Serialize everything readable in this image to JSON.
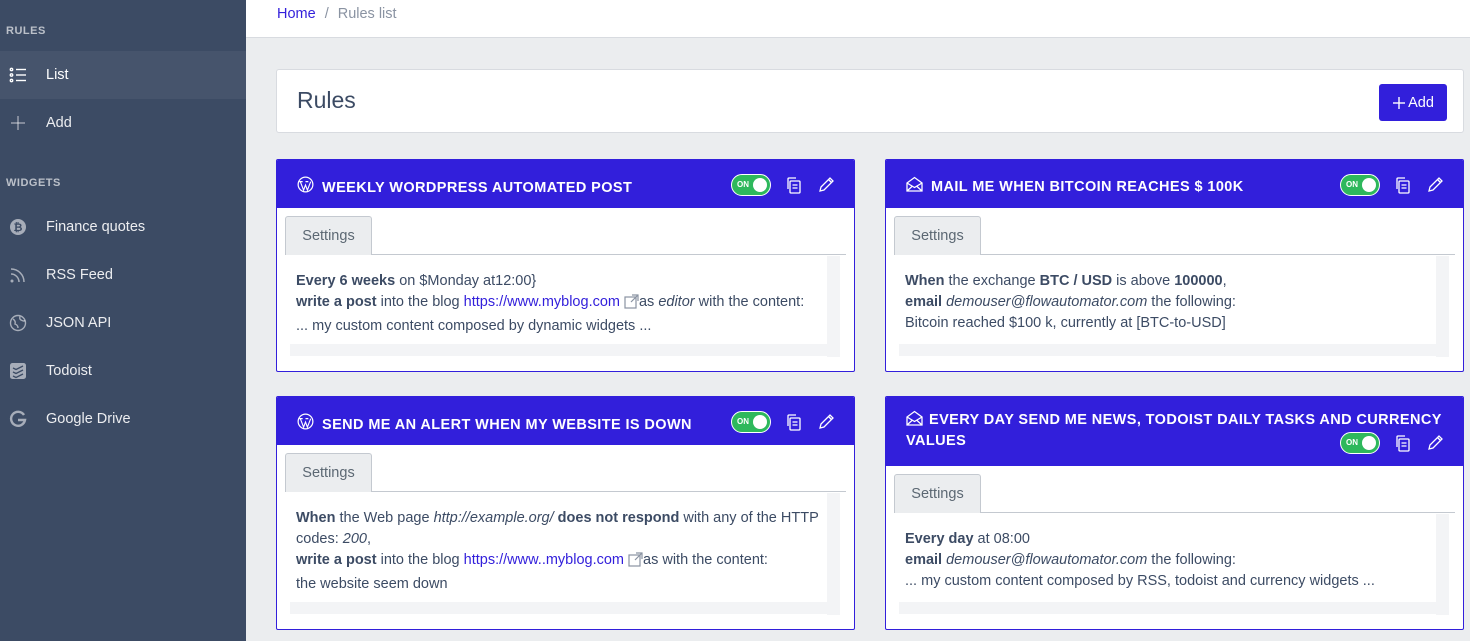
{
  "sidebar": {
    "rules_title": "RULES",
    "rules_items": [
      {
        "label": "List",
        "icon": "list-icon",
        "active": true
      },
      {
        "label": "Add",
        "icon": "plus-icon",
        "active": false
      }
    ],
    "widgets_title": "WIDGETS",
    "widget_items": [
      {
        "label": "Finance quotes",
        "icon": "bitcoin-icon"
      },
      {
        "label": "RSS Feed",
        "icon": "rss-icon"
      },
      {
        "label": "JSON API",
        "icon": "globe-icon"
      },
      {
        "label": "Todoist",
        "icon": "todoist-icon"
      },
      {
        "label": "Google Drive",
        "icon": "google-icon"
      }
    ]
  },
  "breadcrumb": {
    "home": "Home",
    "separator": "/",
    "current": "Rules list"
  },
  "page": {
    "title": "Rules",
    "add_label": "Add"
  },
  "settings_tab_label": "Settings",
  "toggle_label": "ON",
  "rules": [
    {
      "title": "WEEKLY WORDPRESS AUTOMATED POST",
      "icon": "wordpress-icon",
      "line1": {
        "b1": "Every 6 weeks",
        "t1": " on $Monday at12:00}"
      },
      "line2": {
        "b1": "write a post",
        "t1": " into the blog ",
        "link": "https://www.myblog.com",
        "t2": "as ",
        "i1": "editor",
        "t3": " with the content:"
      },
      "line3": "... my custom content composed by dynamic widgets ..."
    },
    {
      "title": "MAIL ME WHEN BITCOIN REACHES $ 100K",
      "icon": "envelope-icon",
      "line1": {
        "b1": "When",
        "t1": " the exchange ",
        "b2": "BTC / USD",
        "t2": " is above ",
        "b3": "100000",
        "t3": ","
      },
      "line2": {
        "b1": "email",
        "i1": " demouser@flowautomator.com",
        "t1": "  the following:"
      },
      "line3": "Bitcoin reached $100 k, currently at [BTC-to-USD]"
    },
    {
      "title": "SEND ME AN ALERT WHEN MY WEBSITE IS DOWN",
      "icon": "wordpress-icon",
      "line1": {
        "b1": "When",
        "t1": " the Web page ",
        "i1": "http://example.org/",
        "b2": " does not respond",
        "t2": " with any of the HTTP codes: ",
        "i2": "200",
        "t3": ","
      },
      "line2": {
        "b1": "write a post",
        "t1": " into the blog ",
        "link": "https://www..myblog.com",
        "t2": "as  with the content:"
      },
      "line3": "the website seem down"
    },
    {
      "title": "EVERY DAY SEND ME NEWS, TODOIST DAILY TASKS AND CURRENCY VALUES",
      "icon": "envelope-icon",
      "line1": {
        "b1": "Every day",
        "t1": " at 08:00"
      },
      "line2": {
        "b1": "email",
        "i1": " demouser@flowautomator.com",
        "t1": "  the following:"
      },
      "line3": "... my custom content composed by RSS, todoist and currency widgets ..."
    }
  ],
  "colors": {
    "primary": "#321fdb",
    "sidebar_bg": "#3c4b64",
    "toggle_on": "#2eb85c",
    "page_bg": "#ebedef"
  }
}
